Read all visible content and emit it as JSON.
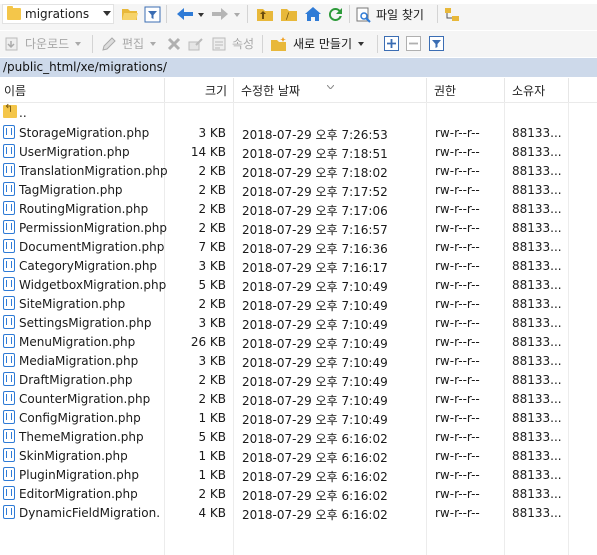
{
  "toolbar": {
    "path_combo_value": "migrations",
    "find_label": "파일 찾기",
    "download_label": "다운로드",
    "edit_label": "편집",
    "properties_label": "속성",
    "new_label": "새로 만들기"
  },
  "path": "/public_html/xe/migrations/",
  "columns": {
    "name": "이름",
    "size": "크기",
    "modified": "수정한 날짜",
    "rights": "권한",
    "owner": "소유자"
  },
  "parent": "..",
  "files": [
    {
      "name": "StorageMigration.php",
      "size": "3 KB",
      "modified": "2018-07-29 오후 7:26:53",
      "rights": "rw-r--r--",
      "owner": "88133..."
    },
    {
      "name": "UserMigration.php",
      "size": "14 KB",
      "modified": "2018-07-29 오후 7:18:51",
      "rights": "rw-r--r--",
      "owner": "88133..."
    },
    {
      "name": "TranslationMigration.php",
      "size": "2 KB",
      "modified": "2018-07-29 오후 7:18:02",
      "rights": "rw-r--r--",
      "owner": "88133..."
    },
    {
      "name": "TagMigration.php",
      "size": "2 KB",
      "modified": "2018-07-29 오후 7:17:52",
      "rights": "rw-r--r--",
      "owner": "88133..."
    },
    {
      "name": "RoutingMigration.php",
      "size": "2 KB",
      "modified": "2018-07-29 오후 7:17:06",
      "rights": "rw-r--r--",
      "owner": "88133..."
    },
    {
      "name": "PermissionMigration.php",
      "size": "2 KB",
      "modified": "2018-07-29 오후 7:16:57",
      "rights": "rw-r--r--",
      "owner": "88133..."
    },
    {
      "name": "DocumentMigration.php",
      "size": "7 KB",
      "modified": "2018-07-29 오후 7:16:36",
      "rights": "rw-r--r--",
      "owner": "88133..."
    },
    {
      "name": "CategoryMigration.php",
      "size": "3 KB",
      "modified": "2018-07-29 오후 7:16:17",
      "rights": "rw-r--r--",
      "owner": "88133..."
    },
    {
      "name": "WidgetboxMigration.php",
      "size": "5 KB",
      "modified": "2018-07-29 오후 7:10:49",
      "rights": "rw-r--r--",
      "owner": "88133..."
    },
    {
      "name": "SiteMigration.php",
      "size": "2 KB",
      "modified": "2018-07-29 오후 7:10:49",
      "rights": "rw-r--r--",
      "owner": "88133..."
    },
    {
      "name": "SettingsMigration.php",
      "size": "3 KB",
      "modified": "2018-07-29 오후 7:10:49",
      "rights": "rw-r--r--",
      "owner": "88133..."
    },
    {
      "name": "MenuMigration.php",
      "size": "26 KB",
      "modified": "2018-07-29 오후 7:10:49",
      "rights": "rw-r--r--",
      "owner": "88133..."
    },
    {
      "name": "MediaMigration.php",
      "size": "3 KB",
      "modified": "2018-07-29 오후 7:10:49",
      "rights": "rw-r--r--",
      "owner": "88133..."
    },
    {
      "name": "DraftMigration.php",
      "size": "2 KB",
      "modified": "2018-07-29 오후 7:10:49",
      "rights": "rw-r--r--",
      "owner": "88133..."
    },
    {
      "name": "CounterMigration.php",
      "size": "2 KB",
      "modified": "2018-07-29 오후 7:10:49",
      "rights": "rw-r--r--",
      "owner": "88133..."
    },
    {
      "name": "ConfigMigration.php",
      "size": "1 KB",
      "modified": "2018-07-29 오후 7:10:49",
      "rights": "rw-r--r--",
      "owner": "88133..."
    },
    {
      "name": "ThemeMigration.php",
      "size": "5 KB",
      "modified": "2018-07-29 오후 6:16:02",
      "rights": "rw-r--r--",
      "owner": "88133..."
    },
    {
      "name": "SkinMigration.php",
      "size": "1 KB",
      "modified": "2018-07-29 오후 6:16:02",
      "rights": "rw-r--r--",
      "owner": "88133..."
    },
    {
      "name": "PluginMigration.php",
      "size": "1 KB",
      "modified": "2018-07-29 오후 6:16:02",
      "rights": "rw-r--r--",
      "owner": "88133..."
    },
    {
      "name": "EditorMigration.php",
      "size": "2 KB",
      "modified": "2018-07-29 오후 6:16:02",
      "rights": "rw-r--r--",
      "owner": "88133..."
    },
    {
      "name": "DynamicFieldMigration.",
      "size": "4 KB",
      "modified": "2018-07-29 오후 6:16:02",
      "rights": "rw-r--r--",
      "owner": "88133..."
    }
  ]
}
